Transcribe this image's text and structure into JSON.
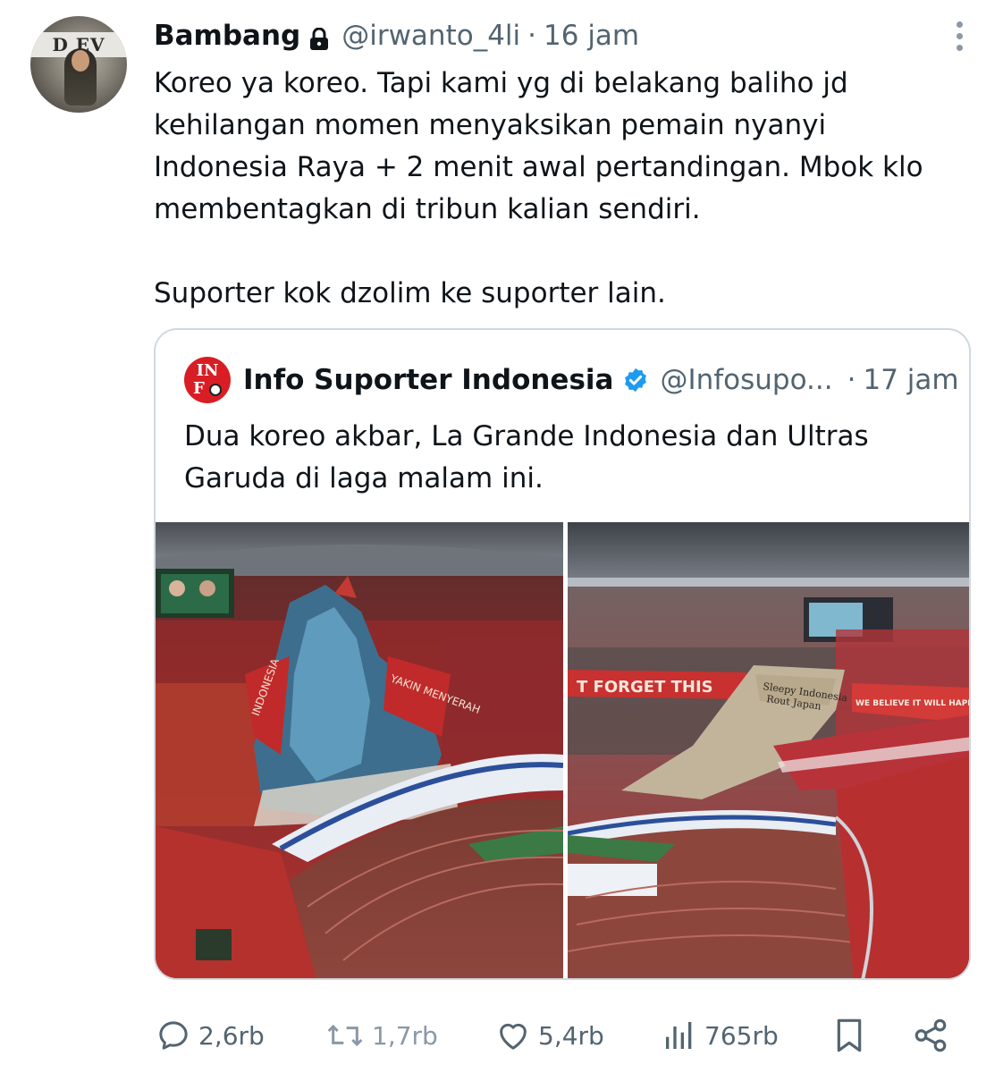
{
  "author": {
    "name": "Bambang",
    "handle": "@irwanto_4li",
    "separator": "·",
    "time": "16 jam",
    "avatar_banner_text": "D EV",
    "protected_icon": "lock-icon"
  },
  "tweet": {
    "text": "Koreo ya koreo. Tapi kami yg di belakang baliho jd kehilangan momen menyaksikan pemain nyanyi Indonesia Raya + 2 menit awal pertandingan. Mbok klo membentagkan di tribun kalian sendiri.\n\nSuporter kok dzolim ke suporter lain."
  },
  "quoted": {
    "name": "Info Suporter Indonesia",
    "handle": "@Infosupo...",
    "separator": "·",
    "time": "17 jam",
    "avatar_text_line1": "IN",
    "avatar_text_line2": "F",
    "verified_icon": "verified-badge-icon",
    "text": "Dua koreo akbar, La Grande Indonesia dan Ultras Garuda di laga malam ini.",
    "photos": [
      {
        "name": "photo-koreo-la-grande",
        "banner_text_a": "YAKIN MENYERAH",
        "banner_text_b": "INDONESIA"
      },
      {
        "name": "photo-koreo-ultras-garuda",
        "banner_text_a": "T FORGET THIS",
        "banner_text_b": "WE BELIEVE IT WILL HAPPEN AGAIN",
        "tifo_text_1": "Sleepy Indonesia",
        "tifo_text_2": "Rout Japan"
      }
    ]
  },
  "actions": {
    "replies": "2,6rb",
    "retweets": "1,7rb",
    "likes": "5,4rb",
    "views": "765rb"
  },
  "colors": {
    "text": "#0f1419",
    "muted": "#536471",
    "verified": "#1d9bf0",
    "border": "#cfd9de"
  }
}
